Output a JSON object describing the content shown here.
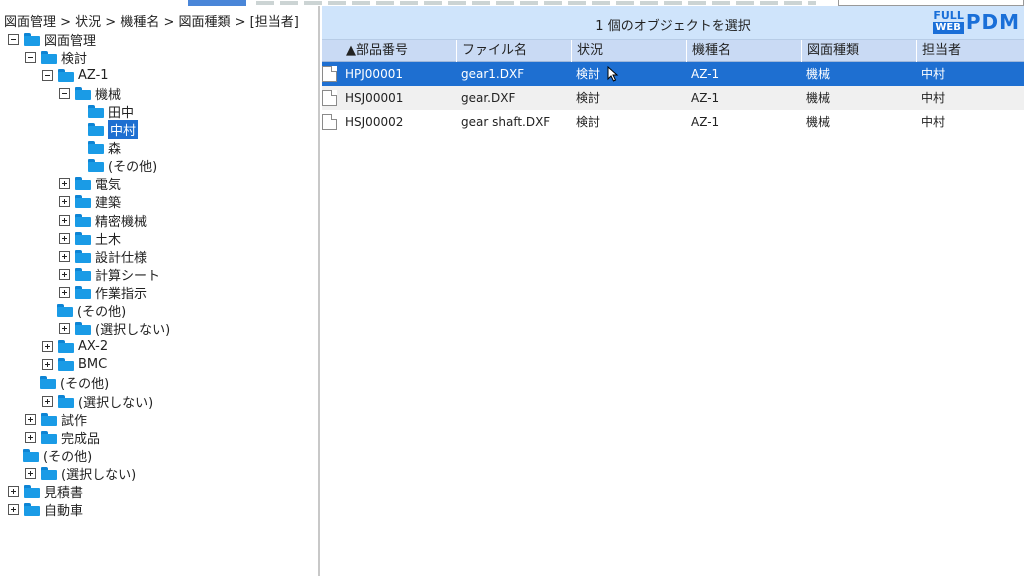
{
  "breadcrumb": "図面管理 > 状況 > 機種名 > 図面種類 > [担当者]",
  "tree": [
    {
      "label": "図面管理",
      "depth": 0,
      "toggle": "minus"
    },
    {
      "label": "検討",
      "depth": 1,
      "toggle": "minus"
    },
    {
      "label": "AZ-1",
      "depth": 2,
      "toggle": "minus"
    },
    {
      "label": "機械",
      "depth": 3,
      "toggle": "minus"
    },
    {
      "label": "田中",
      "depth": 4,
      "toggle": "none"
    },
    {
      "label": "中村",
      "depth": 4,
      "toggle": "none",
      "selected": true
    },
    {
      "label": "森",
      "depth": 4,
      "toggle": "none"
    },
    {
      "label": "(その他)",
      "depth": 4,
      "toggle": "none"
    },
    {
      "label": "電気",
      "depth": 3,
      "toggle": "plus"
    },
    {
      "label": "建築",
      "depth": 3,
      "toggle": "plus"
    },
    {
      "label": "精密機械",
      "depth": 3,
      "toggle": "plus"
    },
    {
      "label": "土木",
      "depth": 3,
      "toggle": "plus"
    },
    {
      "label": "設計仕様",
      "depth": 3,
      "toggle": "plus"
    },
    {
      "label": "計算シート",
      "depth": 3,
      "toggle": "plus"
    },
    {
      "label": "作業指示",
      "depth": 3,
      "toggle": "plus"
    },
    {
      "label": "(その他)",
      "depth": 3,
      "toggle": "leaf"
    },
    {
      "label": "(選択しない)",
      "depth": 3,
      "toggle": "plus"
    },
    {
      "label": "AX-2",
      "depth": 2,
      "toggle": "plus"
    },
    {
      "label": "BMC",
      "depth": 2,
      "toggle": "plus"
    },
    {
      "label": "(その他)",
      "depth": 2,
      "toggle": "leaf"
    },
    {
      "label": "(選択しない)",
      "depth": 2,
      "toggle": "plus"
    },
    {
      "label": "試作",
      "depth": 1,
      "toggle": "plus"
    },
    {
      "label": "完成品",
      "depth": 1,
      "toggle": "plus"
    },
    {
      "label": "(その他)",
      "depth": 1,
      "toggle": "leaf"
    },
    {
      "label": "(選択しない)",
      "depth": 1,
      "toggle": "plus"
    },
    {
      "label": "見積書",
      "depth": 0,
      "toggle": "plus"
    },
    {
      "label": "自動車",
      "depth": 0,
      "toggle": "plus"
    }
  ],
  "header": {
    "selection_status": "1 個のオブジェクトを選択",
    "logo_full": "FULL",
    "logo_web": "WEB",
    "logo_pdm": "PDM"
  },
  "columns": [
    "▲部品番号",
    "ファイル名",
    "状況",
    "機種名",
    "図面種類",
    "担当者"
  ],
  "rows": [
    {
      "cells": [
        "HPJ00001",
        "gear1.DXF",
        "検討",
        "AZ-1",
        "機械",
        "中村"
      ],
      "selected": true
    },
    {
      "cells": [
        "HSJ00001",
        "gear.DXF",
        "検討",
        "AZ-1",
        "機械",
        "中村"
      ],
      "selected": false
    },
    {
      "cells": [
        "HSJ00002",
        "gear shaft.DXF",
        "検討",
        "AZ-1",
        "機械",
        "中村"
      ],
      "selected": false
    }
  ],
  "colors": {
    "accent": "#1e6fd1",
    "folder": "#1a9be6",
    "header_bg": "#cfe4fb"
  }
}
